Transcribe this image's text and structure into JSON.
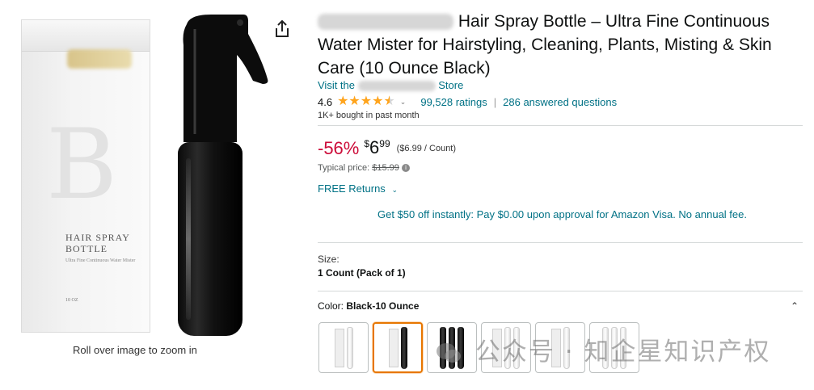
{
  "product": {
    "title_visible": "Hair Spray Bottle – Ultra Fine Continuous Water Mister for Hairstyling, Cleaning, Plants, Misting & Skin Care (10 Ounce Black)",
    "store_prefix": "Visit the",
    "store_suffix": "Store",
    "rating": "4.6",
    "rating_stars": 4.5,
    "ratings_count": "99,528 ratings",
    "answered_questions": "286 answered questions",
    "bought": "1K+ bought in past month",
    "discount": "-56%",
    "price_currency": "$",
    "price_whole": "6",
    "price_fraction": "99",
    "unit_price": "($6.99 / Count)",
    "typical_label": "Typical price:",
    "typical_price": "$15.99",
    "returns": "FREE Returns",
    "card_offer": "Get $50 off instantly: Pay $0.00 upon approval for Amazon Visa. No annual fee.",
    "size_label": "Size:",
    "size_value": "1 Count (Pack of 1)",
    "color_label": "Color:",
    "color_value": "Black-10 Ounce",
    "swatches": [
      "white-single",
      "black-single",
      "black-triple",
      "white-pack",
      "white-pack-2",
      "white-triple"
    ],
    "selected_swatch": 1
  },
  "image": {
    "zoom_hint": "Roll over image to zoom in",
    "box_title": "HAIR SPRAY BOTTLE",
    "box_subtitle": "Ultra Fine Continuous Water Mister",
    "box_size": "10 OZ",
    "box_monogram": "B"
  },
  "watermark": "公众号 · 知企星知识产权",
  "icons": {
    "share": "share-icon",
    "chevron": "chevron-down-icon",
    "info": "info-icon",
    "collapse": "chevron-up-icon",
    "star": "star-icon"
  },
  "colors": {
    "link": "#007185",
    "discount": "#cc0c39",
    "star": "#ffa41c",
    "selected_border": "#e77600"
  }
}
